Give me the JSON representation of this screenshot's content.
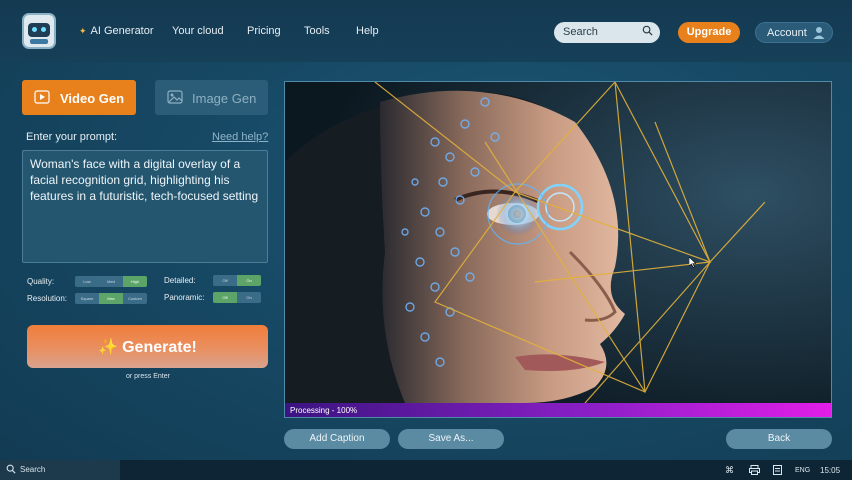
{
  "nav": {
    "items": [
      "AI Generator",
      "Your cloud",
      "Pricing",
      "Tools",
      "Help"
    ],
    "search_placeholder": "Search",
    "upgrade": "Upgrade",
    "account": "Account"
  },
  "modes": {
    "video": "Video Gen",
    "image": "Image Gen"
  },
  "prompt": {
    "label": "Enter your prompt:",
    "help": "Need help?",
    "value": "Woman's face with a digital overlay of a facial recognition grid, highlighting his features in a futuristic, tech-focused setting"
  },
  "options": {
    "quality": {
      "label": "Quality:",
      "choices": [
        "Low",
        "Med",
        "High"
      ],
      "selected": "High"
    },
    "resolution": {
      "label": "Resolution:",
      "choices": [
        "Square",
        "Max",
        "Custom"
      ],
      "selected": "Max"
    },
    "detailed": {
      "label": "Detailed:",
      "choices": [
        "Off",
        "On"
      ],
      "selected": "On"
    },
    "panoramic": {
      "label": "Panoramic:",
      "choices": [
        "Off",
        "On"
      ],
      "selected": "Off"
    }
  },
  "generate": {
    "label": "Generate!",
    "hint": "or press Enter"
  },
  "viewer": {
    "progress_text": "Processing - 100%",
    "progress_fraction": 1.0
  },
  "actions": {
    "add_caption": "Add Caption",
    "save_as": "Save As...",
    "back": "Back"
  },
  "taskbar": {
    "search": "Search",
    "lang": "ENG",
    "time": "15:05"
  },
  "colors": {
    "accent": "#e8801c",
    "toggle_on": "#5da469",
    "progress_end": "#e21ee8"
  }
}
